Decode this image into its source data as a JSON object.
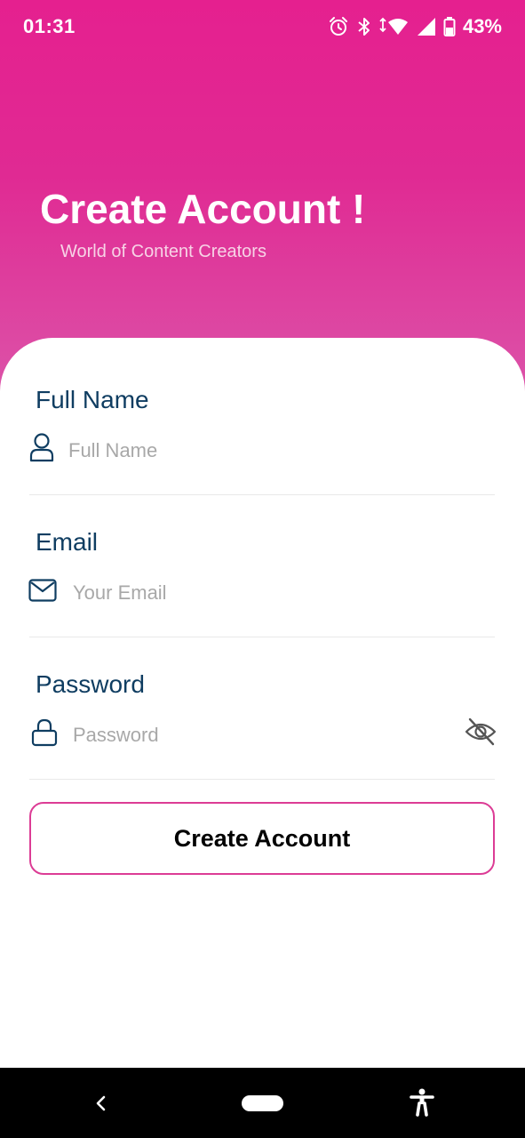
{
  "status_bar": {
    "time": "01:31",
    "battery_percent": "43%",
    "icons": [
      "alarm-icon",
      "bluetooth-icon",
      "wifi-icon",
      "signal-icon",
      "battery-icon"
    ]
  },
  "header": {
    "title": "Create Account !",
    "subtitle": "World of Content Creators"
  },
  "form": {
    "full_name": {
      "label": "Full Name",
      "placeholder": "Full Name",
      "value": "",
      "icon": "user-icon"
    },
    "email": {
      "label": "Email",
      "placeholder": "Your Email",
      "value": "",
      "icon": "mail-icon"
    },
    "password": {
      "label": "Password",
      "placeholder": "Password",
      "value": "",
      "icon": "lock-icon",
      "toggle_icon": "eye-off-icon"
    },
    "submit_label": "Create Account"
  },
  "nav_bar": {
    "icons": [
      "back-icon",
      "home-pill-icon",
      "accessibility-icon"
    ]
  },
  "colors": {
    "header_gradient_top": "#e5208f",
    "header_gradient_bottom": "#dc52a8",
    "label_color": "#0f3d61",
    "button_border": "#dc3c95",
    "placeholder_color": "#a8a8a8"
  }
}
